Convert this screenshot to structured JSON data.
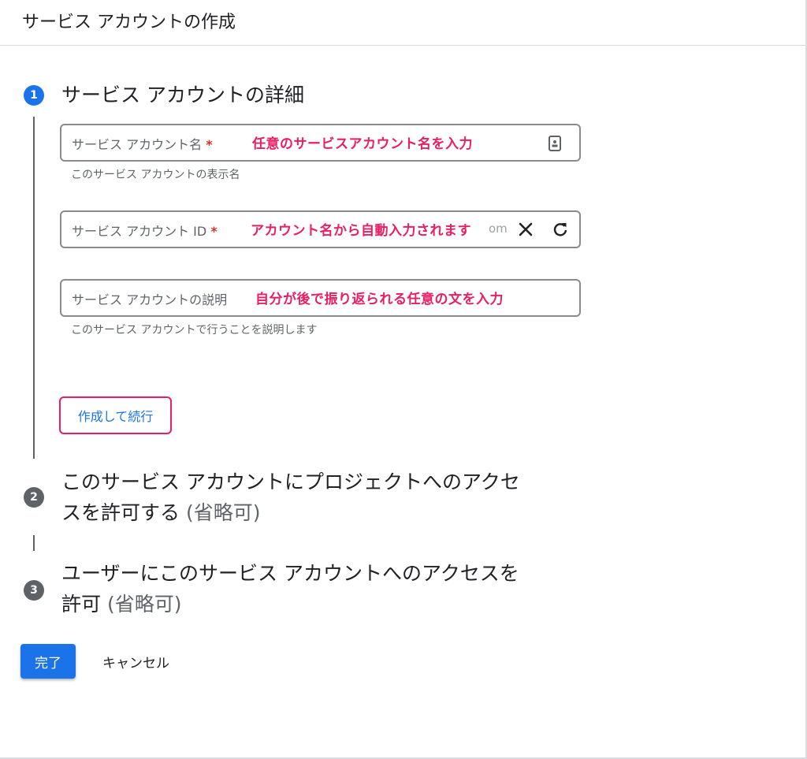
{
  "header": {
    "title": "サービス アカウントの作成"
  },
  "steps": [
    {
      "number": "1",
      "title": "サービス アカウントの詳細"
    },
    {
      "number": "2",
      "title_line1": "このサービス アカウントにプロジェクトへのアクセ",
      "title_line2": "スを許可する",
      "optional": "(省略可)"
    },
    {
      "number": "3",
      "title_line1": "ユーザーにこのサービス アカウントへのアクセスを",
      "title_line2": "許可",
      "optional": "(省略可)"
    }
  ],
  "fields": {
    "name": {
      "label": "サービス アカウント名",
      "required_mark": "*",
      "annotation": "任意のサービスアカウント名を入力",
      "hint": "このサービス アカウントの表示名",
      "icon": "badge-icon"
    },
    "id": {
      "label": "サービス アカウント ID",
      "required_mark": "*",
      "annotation": "アカウント名から自動入力されます",
      "ghost_value": "om",
      "clear_icon": "close-icon",
      "refresh_icon": "refresh-icon"
    },
    "description": {
      "label": "サービス アカウントの説明",
      "annotation": "自分が後で振り返られる任意の文を入力",
      "hint": "このサービス アカウントで行うことを説明します"
    }
  },
  "buttons": {
    "create_continue": "作成して続行",
    "done": "完了",
    "cancel": "キャンセル"
  },
  "colors": {
    "primary": "#1a73e8",
    "annotation": "#e91e63",
    "required": "#d93025",
    "step_inactive": "#5f6368"
  }
}
